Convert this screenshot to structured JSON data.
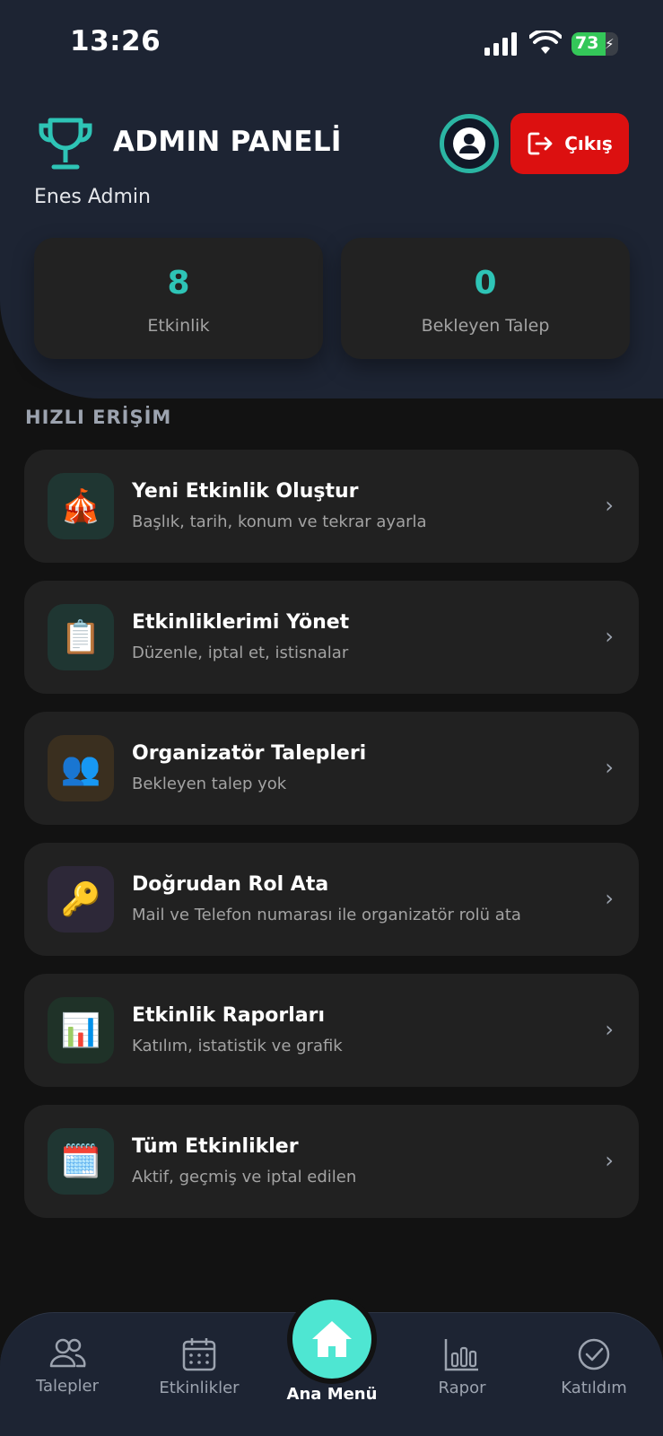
{
  "status_bar": {
    "time": "13:26",
    "battery": "73",
    "battery_level": 0.73
  },
  "header": {
    "title": "ADMIN PANELİ",
    "user_name": "Enes Admin",
    "logout_label": "Çıkış"
  },
  "stats": [
    {
      "value": "8",
      "label": "Etkinlik"
    },
    {
      "value": "0",
      "label": "Bekleyen Talep"
    }
  ],
  "section_title": "HIZLI ERİŞİM",
  "menu": [
    {
      "icon": "🎪",
      "icon_name": "circus-tent-icon",
      "title": "Yeni Etkinlik Oluştur",
      "desc": "Başlık, tarih, konum ve tekrar ayarla",
      "icon_bg": "#1f3632"
    },
    {
      "icon": "📋",
      "icon_name": "clipboard-icon",
      "title": "Etkinliklerimi Yönet",
      "desc": "Düzenle, iptal et, istisnalar",
      "icon_bg": "#1f3632"
    },
    {
      "icon": "👥",
      "icon_name": "users-icon",
      "title": "Organizatör Talepleri",
      "desc": "Bekleyen talep yok",
      "icon_bg": "#3a2f1f"
    },
    {
      "icon": "🔑",
      "icon_name": "key-icon",
      "title": "Doğrudan Rol Ata",
      "desc": "Mail ve Telefon numarası ile organizatör rolü ata",
      "icon_bg": "#2d2838"
    },
    {
      "icon": "📊",
      "icon_name": "bar-chart-icon",
      "title": "Etkinlik Raporları",
      "desc": "Katılım, istatistik ve grafik",
      "icon_bg": "#1f3228"
    },
    {
      "icon": "🗓️",
      "icon_name": "calendar-icon",
      "title": "Tüm Etkinlikler",
      "desc": "Aktif, geçmiş ve iptal edilen",
      "icon_bg": "#1f3632"
    }
  ],
  "bottom_nav": {
    "items": [
      "Talepler",
      "Etkinlikler",
      "Ana Menü",
      "Rapor",
      "Katıldım"
    ]
  },
  "colors": {
    "accent": "#2ec4b6",
    "header_bg": "#1d2433",
    "logout": "#dc1010",
    "fab": "#4ee6d2"
  }
}
